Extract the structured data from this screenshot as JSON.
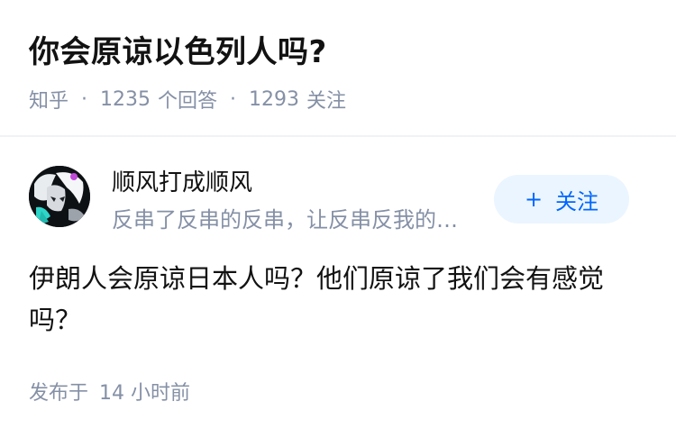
{
  "question": {
    "title": "你会原谅以色列人吗?",
    "source": "知乎",
    "separator": "·",
    "answer_count": "1235",
    "answer_label": "个回答",
    "follower_count": "1293",
    "follower_label": "关注"
  },
  "author": {
    "name": "顺风打成顺风",
    "bio": "反串了反串的反串，让反串反我的…",
    "avatar_icon": "anime-avatar-icon"
  },
  "follow_button": {
    "icon": "+",
    "label": "关注"
  },
  "answer": {
    "content": "伊朗人会原谅日本人吗？他们原谅了我们会有感觉吗？",
    "published_prefix": "发布于",
    "published_time": "14 小时前"
  },
  "colors": {
    "title": "#121212",
    "meta": "#8590a6",
    "accent": "#0066ff",
    "follow_bg": "#ebf5ff",
    "divider": "#f0f2f7"
  }
}
